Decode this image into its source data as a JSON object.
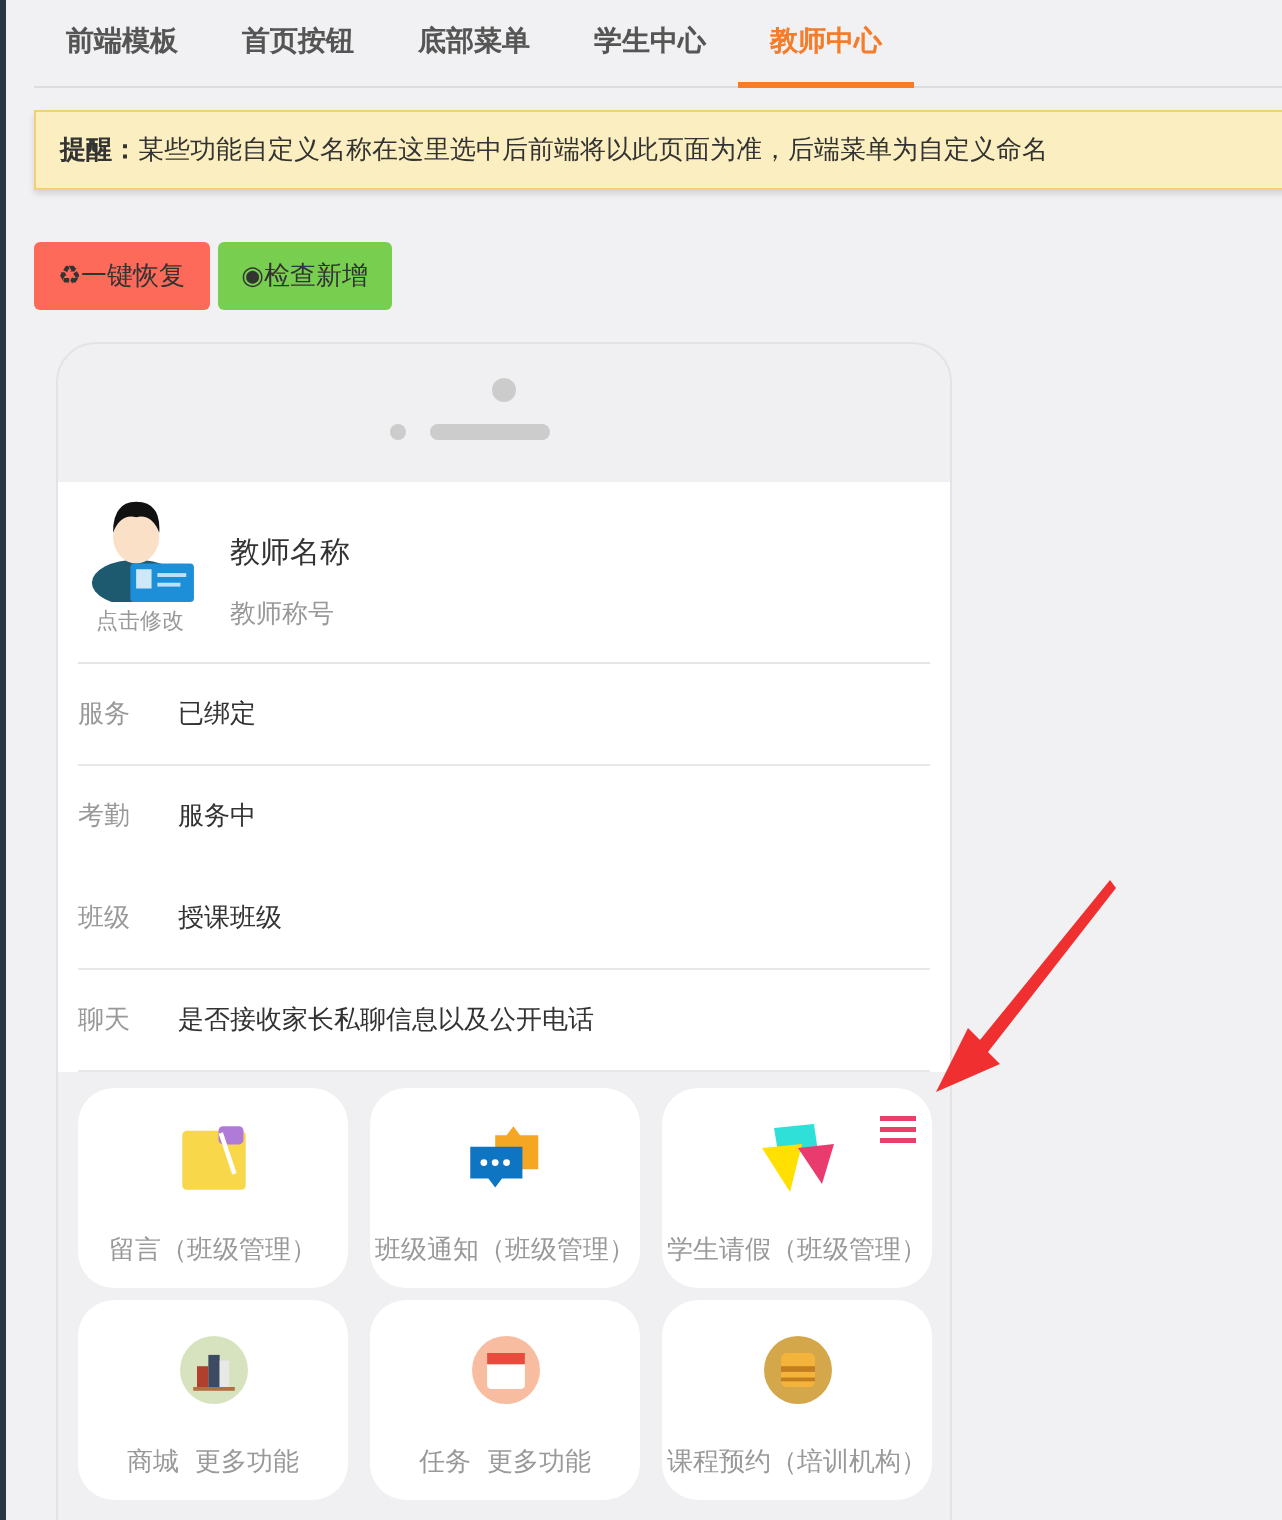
{
  "tabs": [
    {
      "label": "前端模板",
      "selected": false
    },
    {
      "label": "首页按钮",
      "selected": false
    },
    {
      "label": "底部菜单",
      "selected": false
    },
    {
      "label": "学生中心",
      "selected": false
    },
    {
      "label": "教师中心",
      "selected": true
    }
  ],
  "notice": {
    "label": "提醒：",
    "text": "某些功能自定义名称在这里选中后前端将以此页面为准，后端菜单为自定义命名"
  },
  "buttons": [
    {
      "kind": "restore",
      "label": "♻一键恢复"
    },
    {
      "kind": "check",
      "label": "◉检查新增"
    }
  ],
  "profile": {
    "avatar_caption": "点击修改",
    "name": "教师名称",
    "title": "教师称号"
  },
  "info_rows": [
    {
      "label": "服务",
      "value": "已绑定"
    },
    {
      "label": "考勤",
      "value": "服务中"
    },
    {
      "label": "班级",
      "value": "授课班级"
    },
    {
      "label": "聊天",
      "value": "是否接收家长私聊信息以及公开电话"
    }
  ],
  "tiles": [
    {
      "label": "留言（班级管理）",
      "menu": false
    },
    {
      "label": "班级通知（班级管理）",
      "menu": false
    },
    {
      "label": "学生请假（班级管理）",
      "menu": true
    },
    {
      "label": "商城  更多功能",
      "menu": false
    },
    {
      "label": "任务  更多功能",
      "menu": false
    },
    {
      "label": "课程预约（培训机构）",
      "menu": false
    }
  ]
}
